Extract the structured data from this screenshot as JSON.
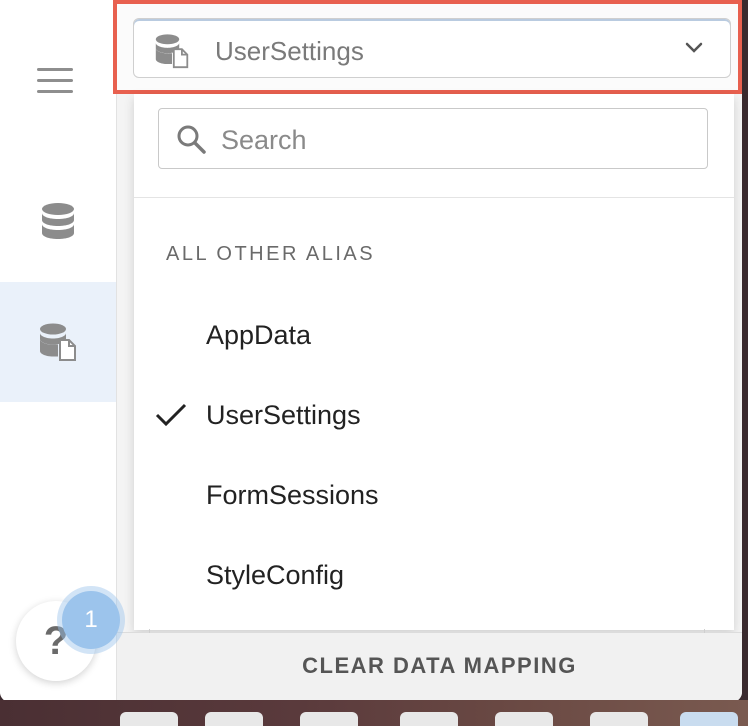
{
  "selector": {
    "selected_alias": "UserSettings",
    "icon": "database-file-icon",
    "chevron": "chevron-down-icon"
  },
  "search": {
    "placeholder": "Search"
  },
  "dropdown": {
    "section_title": "ALL OTHER ALIAS",
    "options": [
      {
        "label": "AppData",
        "selected": false
      },
      {
        "label": "UserSettings",
        "selected": true
      },
      {
        "label": "FormSessions",
        "selected": false
      },
      {
        "label": "StyleConfig",
        "selected": false
      }
    ]
  },
  "footer": {
    "clear_label": "CLEAR DATA MAPPING"
  },
  "help": {
    "label": "?",
    "badge_count": "1"
  },
  "nav": {
    "icons": [
      "menu-icon",
      "database-icon",
      "database-file-icon"
    ]
  },
  "colors": {
    "highlight": "#e8604f",
    "active_nav": "#eaf1fa",
    "badge": "#9cc4ec"
  }
}
